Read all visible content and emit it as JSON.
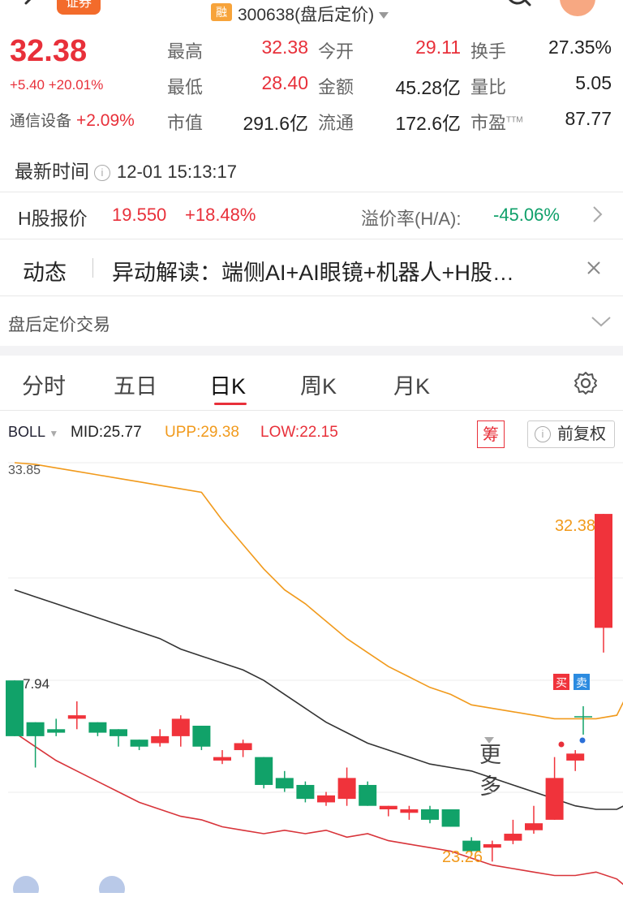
{
  "header": {
    "left_badge": "证券",
    "rong": "融",
    "stock_title": "300638(盘后定价)"
  },
  "quote": {
    "price": "32.38",
    "change": "+5.40 +20.01%",
    "sector_name": "通信设备",
    "sector_change": "+2.09%",
    "stats": [
      {
        "label": "最高",
        "value": "32.38",
        "color": "red"
      },
      {
        "label": "今开",
        "value": "29.11",
        "color": "red"
      },
      {
        "label": "换手",
        "value": "27.35%",
        "color": "dark"
      },
      {
        "label": "最低",
        "value": "28.40",
        "color": "red"
      },
      {
        "label": "金额",
        "value": "45.28亿",
        "color": "dark"
      },
      {
        "label": "量比",
        "value": "5.05",
        "color": "dark"
      },
      {
        "label": "市值",
        "value": "291.6亿",
        "color": "dark"
      },
      {
        "label": "流通",
        "value": "172.6亿",
        "color": "dark"
      },
      {
        "label": "市盈",
        "value": "87.77",
        "color": "dark"
      }
    ],
    "pe_suffix": "TTM"
  },
  "time_row": {
    "label": "最新时间",
    "value": "12-01 15:13:17"
  },
  "hshare": {
    "label": "H股报价",
    "price": "19.550",
    "change": "+18.48%",
    "premium_label": "溢价率(H/A):",
    "premium_value": "-45.06%"
  },
  "news": {
    "tag": "动态",
    "text": "异动解读：端侧AI+AI眼镜+机器人+H股…"
  },
  "post_trade": {
    "label": "盘后定价交易"
  },
  "tabs": [
    "分时",
    "五日",
    "日K",
    "周K",
    "月K",
    "更多"
  ],
  "indicator": {
    "name": "BOLL",
    "mid": "MID:25.77",
    "upp": "UPP:29.38",
    "low": "LOW:22.15",
    "chou": "筹",
    "fuquan": "前复权"
  },
  "chart_labels": {
    "top": "33.85",
    "left_mid": "7.94",
    "high": "32.38",
    "low": "23.26",
    "buy": "买",
    "sell": "卖"
  },
  "colors": {
    "up": "#f0333b",
    "down": "#11a269",
    "upp": "#f19a1c",
    "mid": "#333333",
    "low": "#d8343a",
    "accent": "#e8303a"
  },
  "chart_data": {
    "type": "candlestick",
    "price_range": [
      21.5,
      33.85
    ],
    "candles": [
      {
        "o": 27.6,
        "c": 26.0,
        "h": 27.6,
        "l": 26.0
      },
      {
        "o": 26.4,
        "c": 26.0,
        "h": 26.4,
        "l": 25.1
      },
      {
        "o": 26.2,
        "c": 26.1,
        "h": 26.5,
        "l": 26.0
      },
      {
        "o": 26.5,
        "c": 26.6,
        "h": 27.0,
        "l": 26.2
      },
      {
        "o": 26.4,
        "c": 26.1,
        "h": 26.4,
        "l": 26.0
      },
      {
        "o": 26.2,
        "c": 26.0,
        "h": 26.2,
        "l": 25.7
      },
      {
        "o": 25.9,
        "c": 25.7,
        "h": 25.9,
        "l": 25.6
      },
      {
        "o": 25.8,
        "c": 26.0,
        "h": 26.2,
        "l": 25.7
      },
      {
        "o": 26.0,
        "c": 26.5,
        "h": 26.6,
        "l": 25.7
      },
      {
        "o": 26.3,
        "c": 25.7,
        "h": 26.3,
        "l": 25.6
      },
      {
        "o": 25.3,
        "c": 25.4,
        "h": 25.6,
        "l": 25.2
      },
      {
        "o": 25.6,
        "c": 25.8,
        "h": 25.9,
        "l": 25.4
      },
      {
        "o": 25.4,
        "c": 24.6,
        "h": 25.4,
        "l": 24.5
      },
      {
        "o": 24.8,
        "c": 24.5,
        "h": 25.0,
        "l": 24.4
      },
      {
        "o": 24.6,
        "c": 24.2,
        "h": 24.7,
        "l": 24.1
      },
      {
        "o": 24.1,
        "c": 24.3,
        "h": 24.4,
        "l": 24.0
      },
      {
        "o": 24.2,
        "c": 24.8,
        "h": 25.1,
        "l": 24.0
      },
      {
        "o": 24.6,
        "c": 24.0,
        "h": 24.7,
        "l": 24.0
      },
      {
        "o": 23.9,
        "c": 24.0,
        "h": 24.0,
        "l": 23.7
      },
      {
        "o": 23.8,
        "c": 23.9,
        "h": 24.0,
        "l": 23.6
      },
      {
        "o": 23.9,
        "c": 23.6,
        "h": 24.0,
        "l": 23.5
      },
      {
        "o": 23.9,
        "c": 23.4,
        "h": 23.9,
        "l": 23.4
      },
      {
        "o": 23.0,
        "c": 22.7,
        "h": 23.1,
        "l": 22.6
      },
      {
        "o": 22.8,
        "c": 22.9,
        "h": 23.0,
        "l": 22.4
      },
      {
        "o": 23.0,
        "c": 23.2,
        "h": 23.6,
        "l": 22.9
      },
      {
        "o": 23.3,
        "c": 23.5,
        "h": 24.0,
        "l": 23.2
      },
      {
        "o": 23.6,
        "c": 24.8,
        "h": 25.4,
        "l": 23.6
      },
      {
        "o": 25.3,
        "c": 25.5,
        "h": 25.6,
        "l": 25.0
      },
      {
        "o": 29.11,
        "c": 32.38,
        "h": 32.38,
        "l": 28.4
      }
    ],
    "upp": [
      33.85,
      33.8,
      33.7,
      33.6,
      33.5,
      33.4,
      33.3,
      33.2,
      33.1,
      33.0,
      32.2,
      31.5,
      30.8,
      30.2,
      29.8,
      29.3,
      28.8,
      28.4,
      28.0,
      27.7,
      27.4,
      27.2,
      26.9,
      26.8,
      26.7,
      26.6,
      26.5,
      26.5,
      26.5,
      26.6,
      27.8
    ],
    "mid": [
      30.2,
      30.0,
      29.8,
      29.6,
      29.4,
      29.2,
      29.0,
      28.8,
      28.5,
      28.3,
      28.1,
      27.9,
      27.6,
      27.2,
      26.8,
      26.4,
      26.1,
      25.8,
      25.6,
      25.4,
      25.2,
      25.1,
      25.0,
      24.8,
      24.6,
      24.4,
      24.2,
      24.0,
      23.9,
      23.9,
      24.2
    ],
    "low": [
      26.1,
      25.7,
      25.3,
      25.0,
      24.7,
      24.4,
      24.1,
      23.9,
      23.7,
      23.6,
      23.4,
      23.3,
      23.2,
      23.3,
      23.2,
      23.3,
      23.1,
      23.2,
      23.0,
      22.9,
      22.8,
      22.7,
      22.5,
      22.3,
      22.2,
      22.1,
      22.0,
      22.0,
      22.1,
      21.9,
      21.4
    ]
  }
}
